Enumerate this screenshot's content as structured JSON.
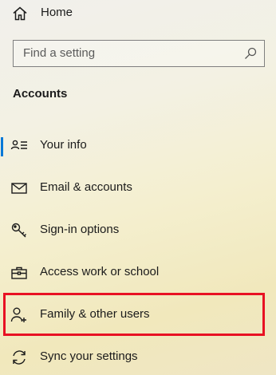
{
  "header": {
    "home_label": "Home"
  },
  "search": {
    "placeholder": "Find a setting"
  },
  "section": {
    "title": "Accounts"
  },
  "nav": {
    "items": [
      {
        "label": "Your info",
        "icon": "person-card-icon",
        "selected": true
      },
      {
        "label": "Email & accounts",
        "icon": "mail-icon"
      },
      {
        "label": "Sign-in options",
        "icon": "key-icon"
      },
      {
        "label": "Access work or school",
        "icon": "briefcase-icon"
      },
      {
        "label": "Family & other users",
        "icon": "add-person-icon",
        "highlighted": true
      },
      {
        "label": "Sync your settings",
        "icon": "sync-icon"
      }
    ]
  },
  "colors": {
    "accent": "#0078d7",
    "highlight_border": "#e81123"
  }
}
